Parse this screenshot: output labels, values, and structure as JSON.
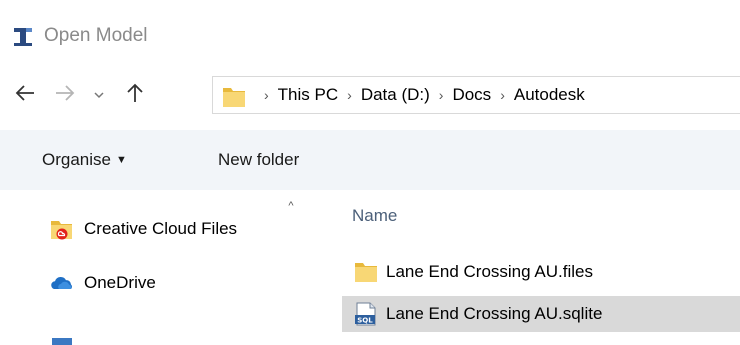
{
  "window": {
    "title": "Open Model",
    "app_icon": "autodesk-infraworks-icon"
  },
  "navigation": {
    "back_icon": "arrow-left-icon",
    "forward_icon": "arrow-right-icon",
    "recent_icon": "chevron-down-icon",
    "up_icon": "arrow-up-icon"
  },
  "address_bar": {
    "folder_icon": "folder-icon",
    "crumbs": [
      "This PC",
      "Data (D:)",
      "Docs",
      "Autodesk"
    ]
  },
  "toolbar": {
    "organise_label": "Organise",
    "organise_arrow": "▼",
    "new_folder_label": "New folder"
  },
  "nav_pane": {
    "scroll_up_glyph": "^",
    "items": [
      {
        "label": "Creative Cloud Files",
        "icon": "creative-cloud-folder-icon"
      },
      {
        "label": "OneDrive",
        "icon": "onedrive-cloud-icon"
      }
    ]
  },
  "file_list": {
    "column_name": "Name",
    "files": [
      {
        "label": "Lane End Crossing AU.files",
        "icon": "folder-icon",
        "selected": false
      },
      {
        "label": "Lane End Crossing AU.sqlite",
        "icon": "sql-file-icon",
        "selected": true
      }
    ]
  },
  "colors": {
    "toolbar_bg": "#f2f5f9",
    "selection_bg": "#d9d9d9",
    "header_text": "#4c607a",
    "folder_yellow": "#f8d775"
  }
}
